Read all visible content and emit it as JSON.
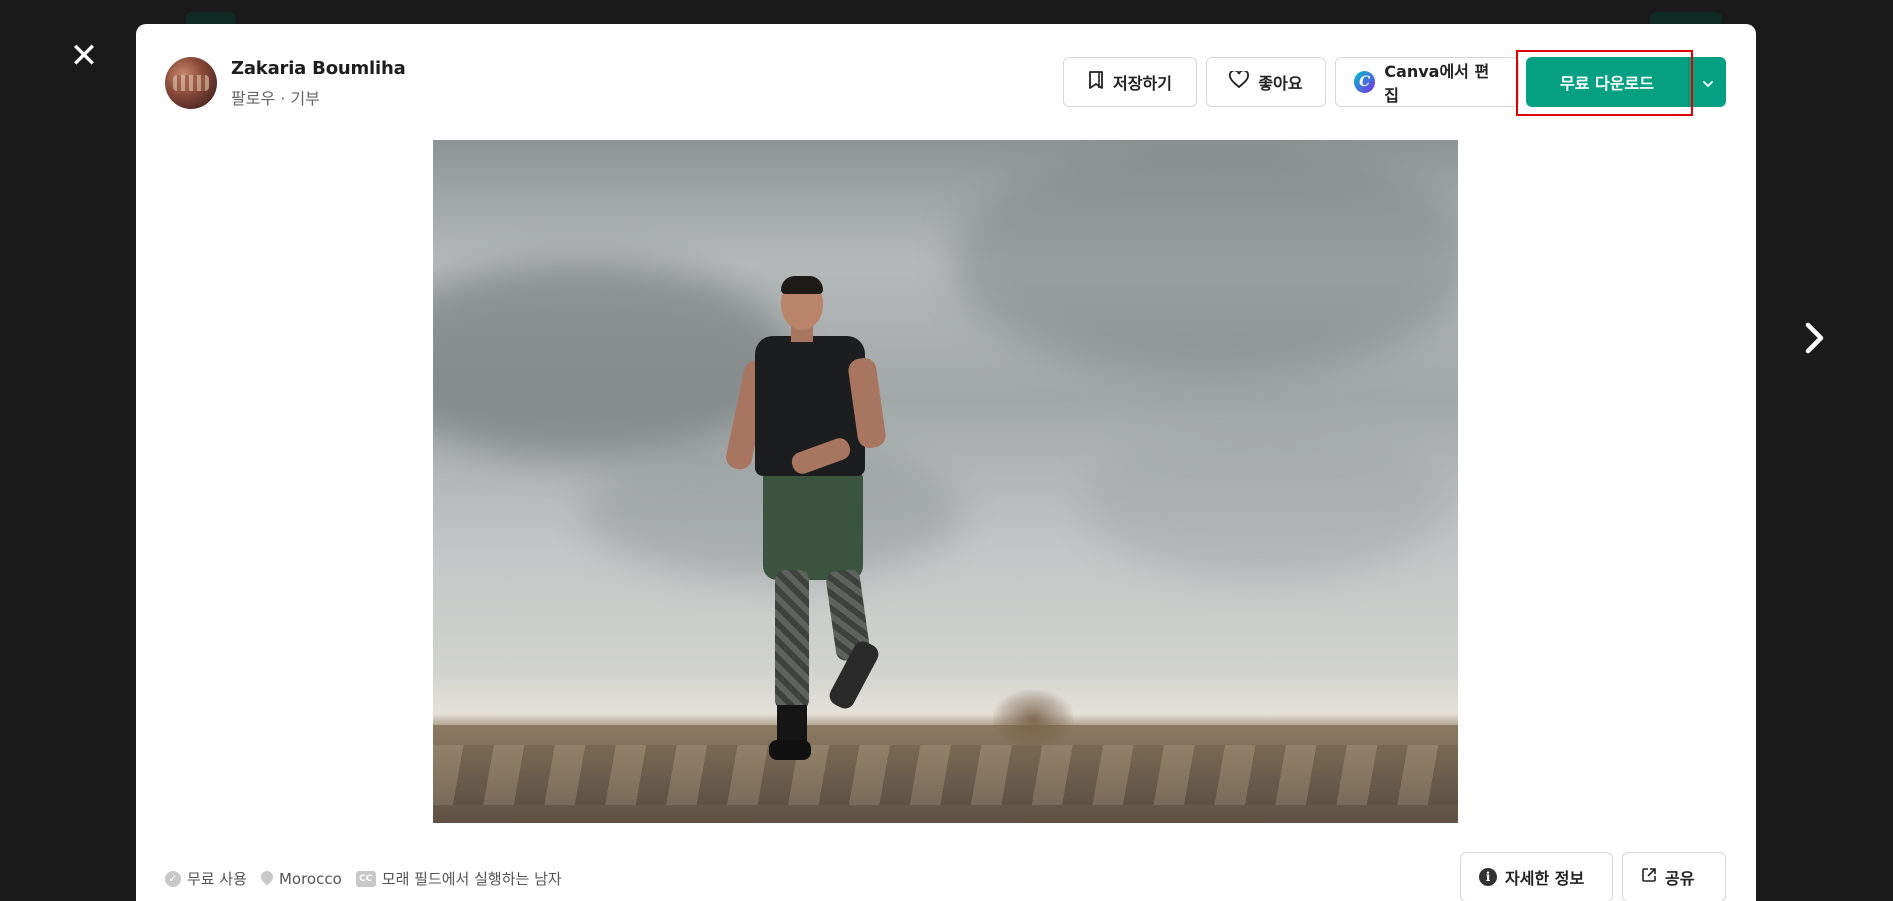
{
  "author": {
    "name": "Zakaria Boumliha",
    "follow": "팔로우",
    "separator": "·",
    "donate": "기부"
  },
  "actions": {
    "save": "저장하기",
    "like": "좋아요",
    "canva": "Canva에서 편집",
    "canva_logo": "C",
    "download": "무료 다운로드"
  },
  "footer": {
    "license": "무료 사용",
    "location": "Morocco",
    "cc_badge": "CC",
    "description": "모래 필드에서 실행하는 남자",
    "info": "자세한 정보",
    "share": "공유",
    "info_glyph": "i"
  },
  "controls": {
    "close": "✕"
  },
  "colors": {
    "brand": "#05a081",
    "highlight": "#e00000"
  },
  "icons": [
    "close-icon",
    "chevron-right-icon",
    "bookmark-icon",
    "heart-icon",
    "canva-logo-icon",
    "chevron-down-icon",
    "check-icon",
    "location-pin-icon",
    "cc-icon",
    "info-icon",
    "share-icon"
  ]
}
